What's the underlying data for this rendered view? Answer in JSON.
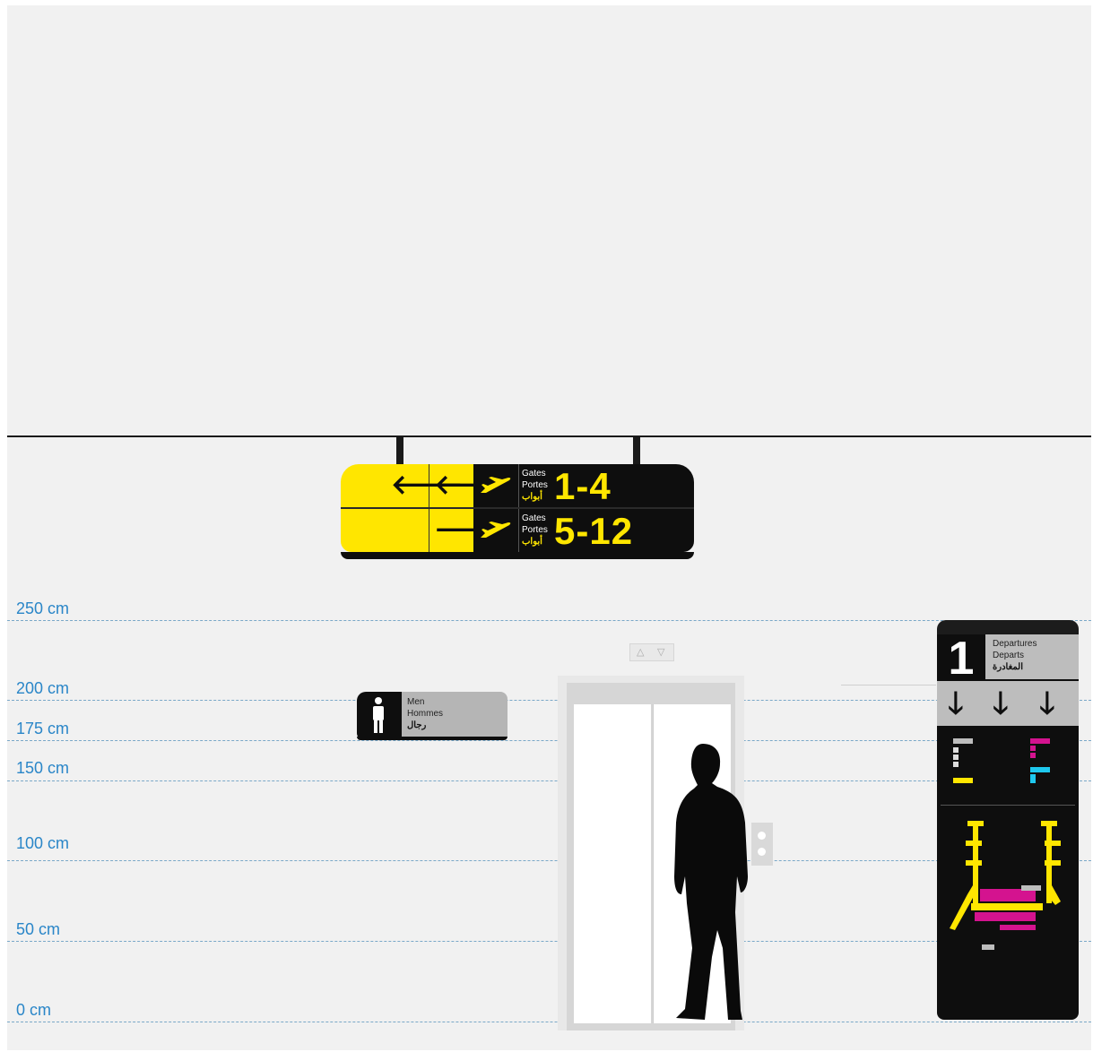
{
  "heights": [
    "250 cm",
    "200 cm",
    "175 cm",
    "150 cm",
    "100 cm",
    "50 cm",
    "0 cm"
  ],
  "overhead_sign": {
    "row1": {
      "labels": [
        "Gates",
        "Portes",
        "أبواب"
      ],
      "number": "1-4"
    },
    "row2": {
      "labels": [
        "Gates",
        "Portes",
        "أبواب"
      ],
      "number": "5-12"
    },
    "arrow_left": "🡐",
    "arrow_right": "🡒",
    "colors": {
      "yellow": "#ffe600",
      "black": "#0e0e0e"
    }
  },
  "restroom_sign": {
    "labels": [
      "Men",
      "Hommes",
      "رجال"
    ],
    "icon": "man-icon"
  },
  "elevator": {
    "up_symbol": "△",
    "down_symbol": "▽"
  },
  "totem": {
    "floor_number": "1",
    "labels": [
      "Departures",
      "Departs",
      "المغادرة"
    ],
    "arrow_glyph": "🡓"
  }
}
